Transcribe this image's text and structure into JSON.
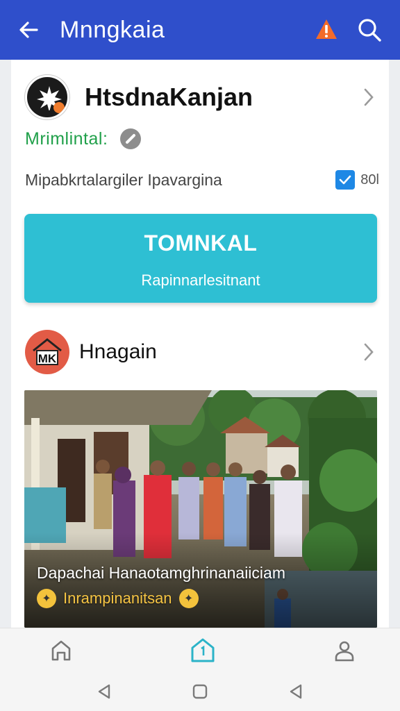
{
  "appbar": {
    "title": "Mnngkaia"
  },
  "profile": {
    "name": "HtsdnaKanjan",
    "status": "Mrimlintal:"
  },
  "setting": {
    "label": "Mipabkrtalargiler Ipavargina",
    "checkbox_label": "80l",
    "checked": true
  },
  "cta": {
    "title": "TOMNKAL",
    "subtitle": "Rapinnarlesitnant"
  },
  "group": {
    "name": "Hnagain",
    "avatar_text": "MK"
  },
  "photo": {
    "caption": "Dapachai Hanaotamghrinanaiiciam",
    "sub": "Inrampinanitsan"
  },
  "colors": {
    "appbar": "#2f4fcb",
    "cta": "#2ebfd3",
    "status": "#20a04a",
    "accent": "#2bb3c8"
  },
  "bottom_nav": [
    {
      "icon": "home-outline-icon"
    },
    {
      "icon": "home-active-icon"
    },
    {
      "icon": "profile-icon"
    }
  ]
}
